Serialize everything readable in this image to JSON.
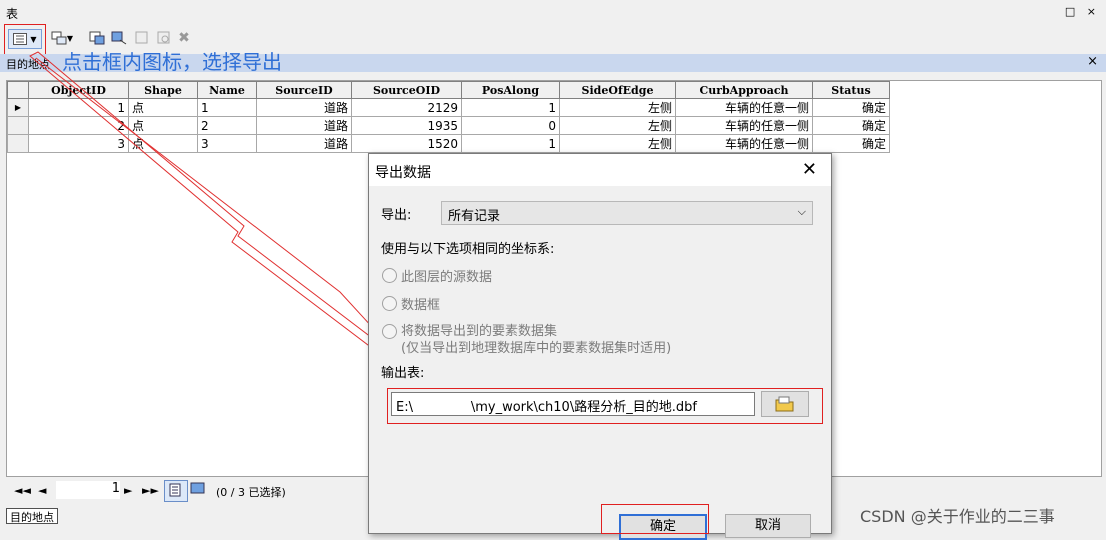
{
  "window": {
    "title": "表",
    "controls": [
      "□",
      "×"
    ]
  },
  "toolbar": {
    "icons": [
      "table-options-icon",
      "related-tables-icon",
      "select-by-attributes-icon",
      "switch-selection-icon",
      "clear-selection-icon",
      "zoom-to-selected-icon",
      "delete-selected-icon"
    ]
  },
  "tab": {
    "label": "目的地点",
    "close": "×"
  },
  "annotation": {
    "text": "点击框内图标，选择导出"
  },
  "table": {
    "columns": [
      "ObjectID",
      "Shape",
      "Name",
      "SourceID",
      "SourceOID",
      "PosAlong",
      "SideOfEdge",
      "CurbApproach",
      "Status"
    ],
    "rows": [
      [
        "1",
        "点",
        "1",
        "道路",
        "2129",
        "1",
        "左侧",
        "车辆的任意一侧",
        "确定"
      ],
      [
        "2",
        "点",
        "2",
        "道路",
        "1935",
        "0",
        "左侧",
        "车辆的任意一侧",
        "确定"
      ],
      [
        "3",
        "点",
        "3",
        "道路",
        "1520",
        "1",
        "左侧",
        "车辆的任意一侧",
        "确定"
      ]
    ]
  },
  "nav": {
    "first": "◄◄",
    "prev": "◄",
    "record": "1",
    "next": "►",
    "last": "►►",
    "status": "(0 / 3 已选择)"
  },
  "bottom_tab": {
    "label": "目的地点"
  },
  "watermark": "CSDN @关于作业的二三事",
  "dialog": {
    "title": "导出数据",
    "close": "✕",
    "export_label": "导出:",
    "export_value": "所有记录",
    "coord_label": "使用与以下选项相同的坐标系:",
    "options": [
      "此图层的源数据",
      "数据框",
      "将数据导出到的要素数据集"
    ],
    "option_note": "(仅当导出到地理数据库中的要素数据集时适用)",
    "output_label": "输出表:",
    "output_path": "E:\\              \\my_work\\ch10\\路程分析_目的地.dbf",
    "ok": "确定",
    "cancel": "取消"
  }
}
